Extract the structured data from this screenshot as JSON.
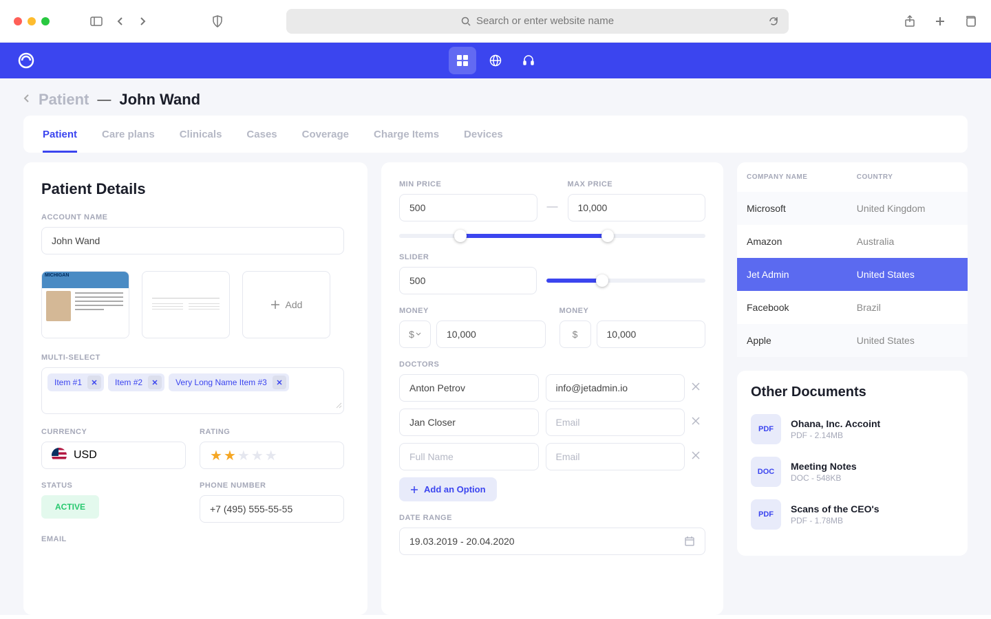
{
  "browser": {
    "searchPlaceholder": "Search or enter website name"
  },
  "breadcrumb": {
    "section": "Patient",
    "name": "John Wand"
  },
  "tabs": [
    "Patient",
    "Care plans",
    "Clinicals",
    "Cases",
    "Coverage",
    "Charge Items",
    "Devices"
  ],
  "activeTab": 0,
  "details": {
    "title": "Patient Details",
    "accountNameLabel": "ACCOUNT NAME",
    "accountName": "John Wand",
    "addLabel": "Add",
    "multiSelectLabel": "MULTI-SELECT",
    "chips": [
      "Item #1",
      "Item #2",
      "Very Long Name Item #3"
    ],
    "currencyLabel": "CURRENCY",
    "currency": "USD",
    "ratingLabel": "RATING",
    "rating": 2,
    "statusLabel": "STATUS",
    "status": "ACTIVE",
    "phoneLabel": "PHONE NUMBER",
    "phone": "+7 (495) 555-55-55",
    "emailLabel": "EMAIL"
  },
  "mid": {
    "minPriceLabel": "MIN PRICE",
    "maxPriceLabel": "MAX PRICE",
    "minPrice": "500",
    "maxPrice": "10,000",
    "sliderLabel": "SLIDER",
    "sliderValue": "500",
    "moneyLabel": "MONEY",
    "money1": "10,000",
    "money2": "10,000",
    "currencySymbol": "$",
    "doctorsLabel": "DOCTORS",
    "doctors": [
      {
        "name": "Anton Petrov",
        "email": "info@jetadmin.io"
      },
      {
        "name": "Jan Closer",
        "email": ""
      },
      {
        "name": "",
        "email": ""
      }
    ],
    "namePlaceholder": "Full Name",
    "emailPlaceholder": "Email",
    "addOption": "Add an Option",
    "dateRangeLabel": "DATE RANGE",
    "dateRange": "19.03.2019 - 20.04.2020"
  },
  "companies": {
    "companyHeader": "COMPANY NAME",
    "countryHeader": "COUNTRY",
    "rows": [
      {
        "company": "Microsoft",
        "country": "United Kingdom"
      },
      {
        "company": "Amazon",
        "country": "Australia"
      },
      {
        "company": "Jet Admin",
        "country": "United States"
      },
      {
        "company": "Facebook",
        "country": "Brazil"
      },
      {
        "company": "Apple",
        "country": "United States"
      }
    ],
    "selectedRow": 2
  },
  "docs": {
    "title": "Other Documents",
    "items": [
      {
        "type": "PDF",
        "name": "Ohana, Inc. Accoint",
        "meta": "PDF  - 2.14MB"
      },
      {
        "type": "DOC",
        "name": "Meeting Notes",
        "meta": "DOC  - 548KB"
      },
      {
        "type": "PDF",
        "name": "Scans of the CEO's",
        "meta": "PDF  - 1.78MB"
      }
    ]
  }
}
